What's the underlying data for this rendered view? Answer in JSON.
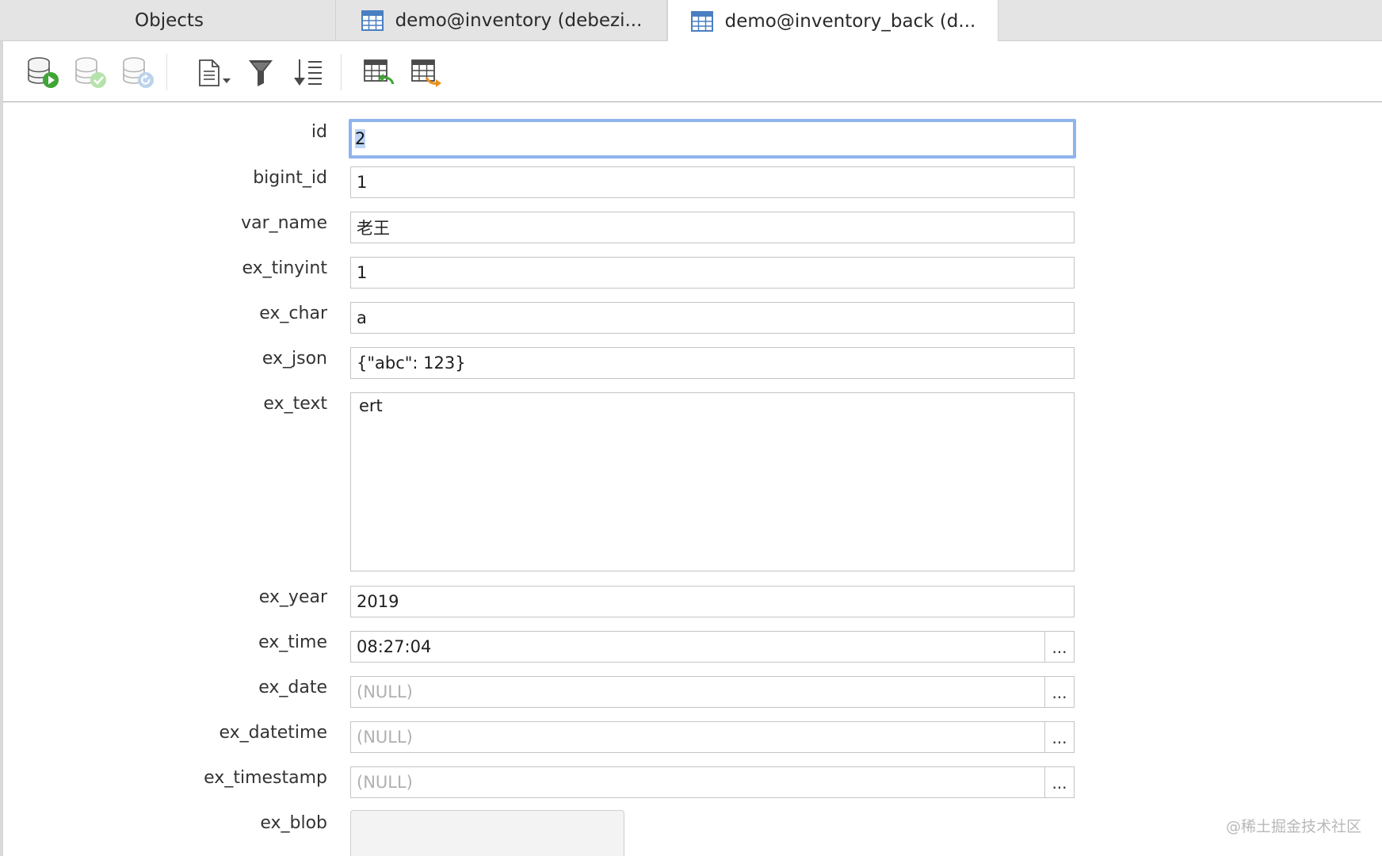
{
  "tabs": [
    {
      "label": "Objects"
    },
    {
      "label": "demo@inventory (debezi..."
    },
    {
      "label": "demo@inventory_back (d..."
    }
  ],
  "toolbar": {
    "buttons": [
      {
        "icon": "db-apply-icon"
      },
      {
        "icon": "db-commit-icon"
      },
      {
        "icon": "db-refresh-icon"
      },
      {
        "icon": "text-view-icon"
      },
      {
        "icon": "filter-icon"
      },
      {
        "icon": "sort-icon"
      },
      {
        "icon": "import-table-icon"
      },
      {
        "icon": "export-table-icon"
      }
    ]
  },
  "fields": {
    "id": {
      "label": "id",
      "value": "2"
    },
    "bigint_id": {
      "label": "bigint_id",
      "value": "1"
    },
    "var_name": {
      "label": "var_name",
      "value": "老王"
    },
    "ex_tinyint": {
      "label": "ex_tinyint",
      "value": "1"
    },
    "ex_char": {
      "label": "ex_char",
      "value": "a"
    },
    "ex_json": {
      "label": "ex_json",
      "value": "{\"abc\": 123}"
    },
    "ex_text": {
      "label": "ex_text",
      "value": "ert"
    },
    "ex_year": {
      "label": "ex_year",
      "value": "2019"
    },
    "ex_time": {
      "label": "ex_time",
      "value": "08:27:04"
    },
    "ex_date": {
      "label": "ex_date",
      "value": "(NULL)"
    },
    "ex_datetime": {
      "label": "ex_datetime",
      "value": "(NULL)"
    },
    "ex_timestamp": {
      "label": "ex_timestamp",
      "value": "(NULL)"
    },
    "ex_blob": {
      "label": "ex_blob",
      "value": ""
    }
  },
  "picker_button_label": "...",
  "watermark": "@稀土掘金技术社区",
  "colors": {
    "tabbar_bg": "#e4e4e4",
    "active_tab_bg": "#ffffff",
    "focus_border": "#8fb4ec",
    "selection": "#bcd4f5",
    "null_text": "#b0b0b0",
    "green_accent": "#3fa535",
    "orange_accent": "#e8901c",
    "table_icon_blue": "#4a7fc1"
  }
}
